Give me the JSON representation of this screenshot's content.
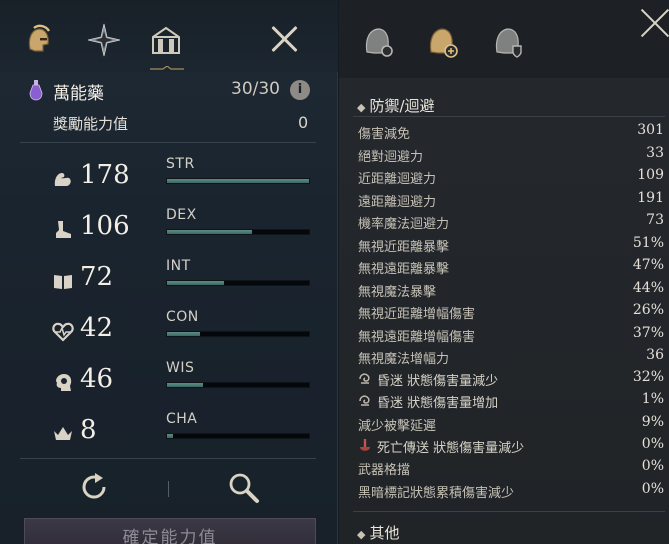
{
  "left": {
    "tabs": [
      {
        "name": "helmet-tab"
      },
      {
        "name": "compass-star-tab"
      },
      {
        "name": "building-tab"
      }
    ],
    "elixir": {
      "label": "萬能藥",
      "value": "30/30",
      "info": "i"
    },
    "bonus": {
      "label": "獎勵能力值",
      "value": "0"
    },
    "stats": [
      {
        "code": "STR",
        "value": "178",
        "icon": "muscle-arm-icon",
        "fill": 1.0
      },
      {
        "code": "DEX",
        "value": "106",
        "icon": "boot-icon",
        "fill": 0.6
      },
      {
        "code": "INT",
        "value": "72",
        "icon": "book-icon",
        "fill": 0.4
      },
      {
        "code": "CON",
        "value": "42",
        "icon": "heart-icon",
        "fill": 0.23
      },
      {
        "code": "WIS",
        "value": "46",
        "icon": "head-icon",
        "fill": 0.25
      },
      {
        "code": "CHA",
        "value": "8",
        "icon": "crown-icon",
        "fill": 0.04
      }
    ],
    "confirm_label": "確定能力值"
  },
  "right": {
    "section_defense": "防禦/迴避",
    "rows": [
      {
        "label": "傷害減免",
        "value": "301"
      },
      {
        "label": "絕對迴避力",
        "value": "33"
      },
      {
        "label": "近距離迴避力",
        "value": "109"
      },
      {
        "label": "遠距離迴避力",
        "value": "191"
      },
      {
        "label": "機率魔法迴避力",
        "value": "73"
      },
      {
        "label": "無視近距離暴擊",
        "value": "51%"
      },
      {
        "label": "無視遠距離暴擊",
        "value": "47%"
      },
      {
        "label": "無視魔法暴擊",
        "value": "44%"
      },
      {
        "label": "無視近距離增幅傷害",
        "value": "26%"
      },
      {
        "label": "無視遠距離增幅傷害",
        "value": "37%"
      },
      {
        "label": "無視魔法增幅力",
        "value": "36"
      },
      {
        "label": "昏迷 狀態傷害量減少",
        "value": "32%",
        "icon": "stun-icon"
      },
      {
        "label": "昏迷 狀態傷害量增加",
        "value": "1%",
        "icon": "stun-icon"
      },
      {
        "label": "減少被擊延遲",
        "value": "9%"
      },
      {
        "label": "死亡傳送 狀態傷害量減少",
        "value": "0%",
        "icon": "death-teleport-icon"
      },
      {
        "label": "武器格擋",
        "value": "0%"
      },
      {
        "label": "黑暗標記狀態累積傷害減少",
        "value": "0%"
      }
    ],
    "section_other": "其他"
  },
  "colors": {
    "bar_fill": "#4f7f78",
    "accent": "#c9a66b"
  }
}
